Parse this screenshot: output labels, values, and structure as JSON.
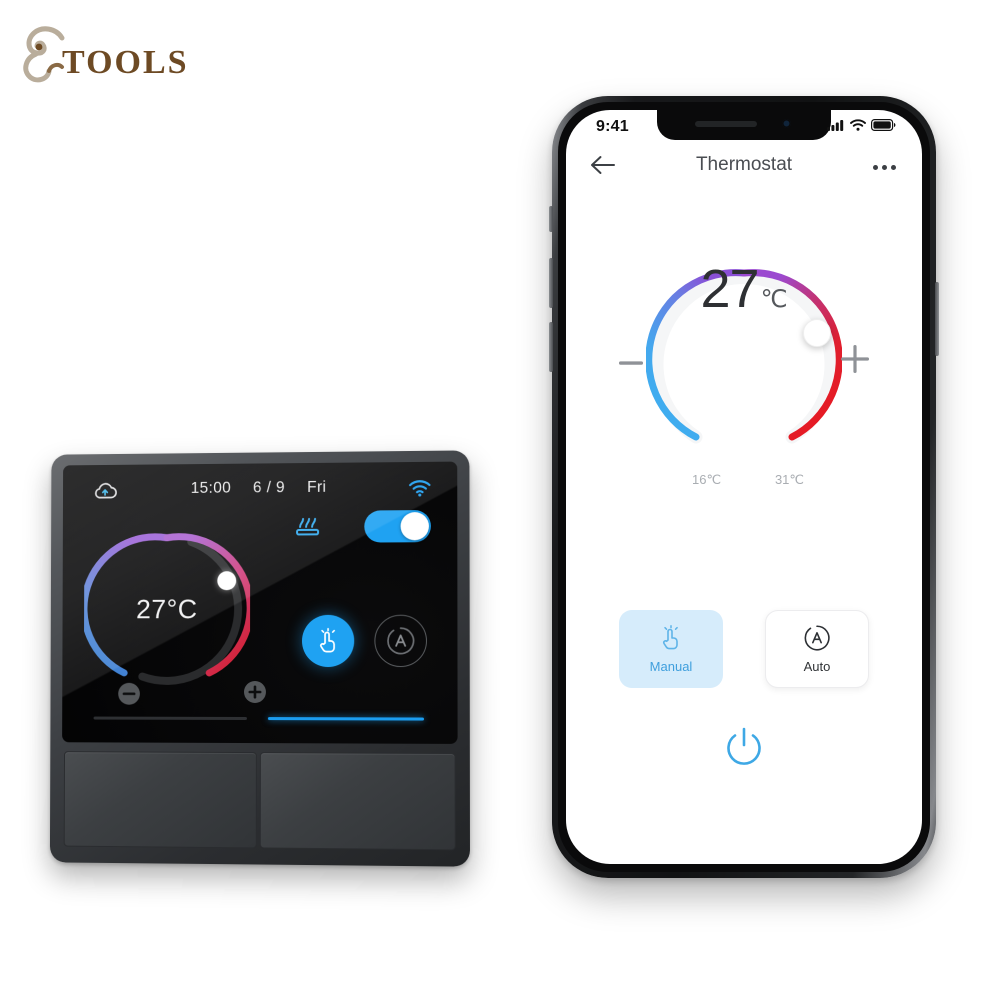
{
  "brand": {
    "name": "TOOLS",
    "icon": "swirl-logo-icon",
    "color": "#6d4a24"
  },
  "device": {
    "name": "smart-thermostat-panel",
    "status_bar": {
      "cloud_icon": "cloud-upload-icon",
      "time": "15:00",
      "date": "6 / 9",
      "weekday": "Fri",
      "wifi_icon": "wifi-icon"
    },
    "dial": {
      "temperature": "27°C",
      "knob_icon": "dial-knob-icon"
    },
    "heating_icon": "floor-heating-icon",
    "toggle": {
      "name": "power-toggle",
      "state": "on",
      "color": "#1fa2f2"
    },
    "minus_label": "−",
    "plus_label": "+",
    "manual_icon": "hand-touch-icon",
    "auto_icon": "auto-a-circle-icon",
    "bar_left_color": "#2e3033",
    "bar_right_color": "#1b9df0",
    "rockers": [
      "rocker-switch-left",
      "rocker-switch-right"
    ]
  },
  "phone": {
    "status_bar": {
      "time": "9:41",
      "signal_icon": "cellular-signal-icon",
      "wifi_icon": "wifi-icon",
      "battery_icon": "battery-full-icon"
    },
    "header": {
      "back_icon": "back-arrow-icon",
      "title": "Thermostat",
      "more_icon": "more-options-icon"
    },
    "dial": {
      "temperature_value": "27",
      "temperature_unit": "℃",
      "range_min": "16℃",
      "range_max": "31℃",
      "knob_icon": "dial-knob-icon",
      "gradient_cold": "#3cb0f0",
      "gradient_mid": "#8a4fd6",
      "gradient_hot": "#e8181f"
    },
    "decrease_label": "−",
    "increase_label": "+",
    "modes": [
      {
        "label": "Manual",
        "icon": "hand-touch-icon",
        "state": "selected"
      },
      {
        "label": "Auto",
        "icon": "auto-a-circle-icon",
        "state": "unselected"
      }
    ],
    "power_icon": "power-icon",
    "power_color": "#3ea8e5"
  }
}
